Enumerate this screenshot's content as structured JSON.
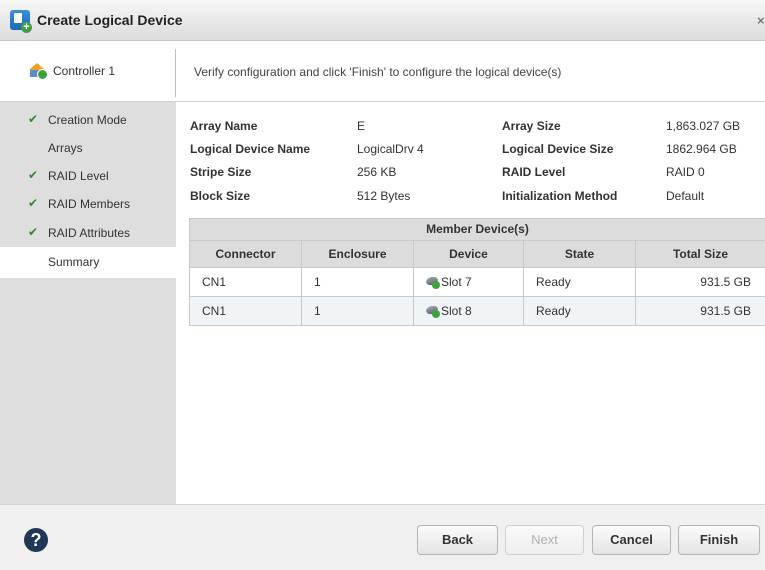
{
  "window": {
    "title": "Create Logical Device",
    "close_glyph": "×"
  },
  "controller": {
    "label": "Controller 1",
    "icon": "controller-icon"
  },
  "instructions": "Verify configuration and click 'Finish' to configure the logical device(s)",
  "nav": [
    {
      "label": "Creation Mode",
      "done": true
    },
    {
      "label": "Arrays",
      "done": false
    },
    {
      "label": "RAID Level",
      "done": true
    },
    {
      "label": "RAID Members",
      "done": true
    },
    {
      "label": "RAID Attributes",
      "done": true
    },
    {
      "label": "Summary",
      "done": false,
      "active": true
    }
  ],
  "summary": {
    "array_name_label": "Array Name",
    "array_name": "E",
    "array_size_label": "Array Size",
    "array_size": "1,863.027 GB",
    "ld_name_label": "Logical Device Name",
    "ld_name": "LogicalDrv 4",
    "ld_size_label": "Logical Device Size",
    "ld_size": "1862.964 GB",
    "stripe_label": "Stripe Size",
    "stripe": "256 KB",
    "raid_label": "RAID Level",
    "raid": "RAID 0",
    "block_label": "Block Size",
    "block": "512 Bytes",
    "init_label": "Initialization Method",
    "init": "Default"
  },
  "members": {
    "caption": "Member Device(s)",
    "columns": [
      "Connector",
      "Enclosure",
      "Device",
      "State",
      "Total Size"
    ],
    "rows": [
      {
        "connector": "CN1",
        "enclosure": "1",
        "device": "Slot 7",
        "state": "Ready",
        "size": "931.5 GB"
      },
      {
        "connector": "CN1",
        "enclosure": "1",
        "device": "Slot 8",
        "state": "Ready",
        "size": "931.5 GB"
      }
    ]
  },
  "footer": {
    "help_glyph": "?",
    "back": "Back",
    "next": "Next",
    "cancel": "Cancel",
    "finish": "Finish"
  },
  "colors": {
    "sidebar": "#dedede",
    "check": "#2e8b2e",
    "header_bg": "#dcdcdc"
  }
}
